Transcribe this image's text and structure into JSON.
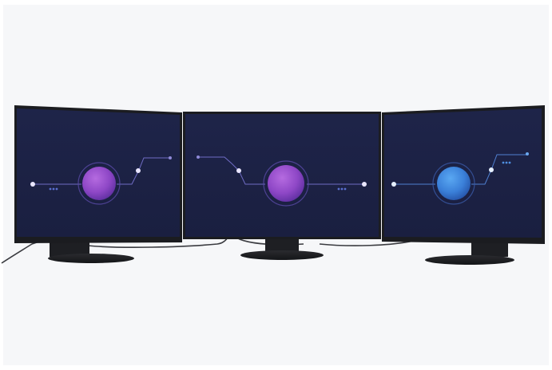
{
  "scene": {
    "background": "#f6f7f9",
    "monitor_color": "#1c1d20",
    "screen_gradient_top": "#1d2348",
    "screen_gradient_bottom": "#1a2042",
    "line_color": "#6f6cc4",
    "accent_purple": "#9b4fd0",
    "accent_blue": "#3f8ae0",
    "monitors": [
      {
        "name": "left-monitor",
        "orb": "purple-orb-icon"
      },
      {
        "name": "center-monitor",
        "orb": "purple-orb-icon"
      },
      {
        "name": "right-monitor",
        "orb": "blue-orb-icon"
      }
    ]
  }
}
